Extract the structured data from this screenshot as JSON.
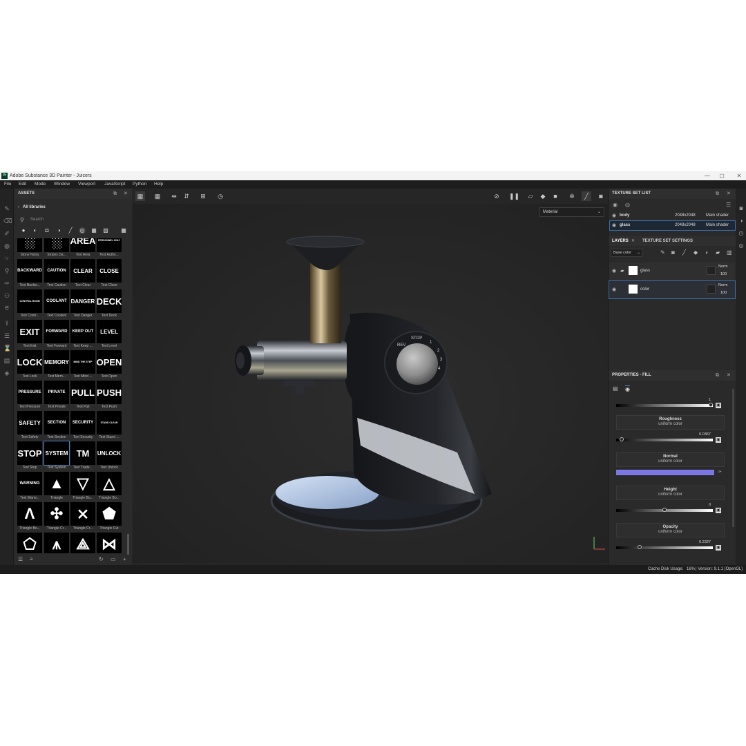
{
  "window": {
    "title": "Adobe Substance 3D Painter - Juicers",
    "app_logo": "Pt"
  },
  "menu": [
    "File",
    "Edit",
    "Mode",
    "Window",
    "Viewport",
    "JavaScript",
    "Python",
    "Help"
  ],
  "assets": {
    "title": "ASSETS",
    "library": "All libraries",
    "search_placeholder": "Search",
    "items": [
      {
        "thumb": "",
        "label": "Stone Noisy"
      },
      {
        "thumb": "",
        "label": "Stripes Da..."
      },
      {
        "thumb": "AREA",
        "label": "Text Area"
      },
      {
        "thumb": "PERSONNEL ONLY",
        "label": "Text Autho..."
      },
      {
        "thumb": "BACKWARD",
        "label": "Text Backw..."
      },
      {
        "thumb": "CAUTION",
        "label": "Text Caution"
      },
      {
        "thumb": "CLEAR",
        "label": "Text Clear"
      },
      {
        "thumb": "CLOSE",
        "label": "Text Close"
      },
      {
        "thumb": "CONTROL ROOM",
        "label": "Text Contr..."
      },
      {
        "thumb": "COOLANT",
        "label": "Text Coolant"
      },
      {
        "thumb": "DANGER",
        "label": "Text Danger"
      },
      {
        "thumb": "DECK",
        "label": "Text Deck"
      },
      {
        "thumb": "EXIT",
        "label": "Text Exit"
      },
      {
        "thumb": "FORWARD",
        "label": "Text Forward"
      },
      {
        "thumb": "KEEP OUT",
        "label": "Text Keep ..."
      },
      {
        "thumb": "LEVEL",
        "label": "Text Level"
      },
      {
        "thumb": "LOCK",
        "label": "Text Lock"
      },
      {
        "thumb": "MEMORY",
        "label": "Text Mem..."
      },
      {
        "thumb": "MIND THE STEP",
        "label": "Text Mind ..."
      },
      {
        "thumb": "OPEN",
        "label": "Text Open"
      },
      {
        "thumb": "PRESSURE",
        "label": "Text Pressure"
      },
      {
        "thumb": "PRIVATE",
        "label": "Text Private"
      },
      {
        "thumb": "PULL",
        "label": "Text Pull"
      },
      {
        "thumb": "PUSH",
        "label": "Text Push"
      },
      {
        "thumb": "SAFETY",
        "label": "Text Safety"
      },
      {
        "thumb": "SECTION",
        "label": "Text Section"
      },
      {
        "thumb": "SECURITY",
        "label": "Text Security"
      },
      {
        "thumb": "STAND CLEAR",
        "label": "Text Stand ..."
      },
      {
        "thumb": "STOP",
        "label": "Text Stop"
      },
      {
        "thumb": "SYSTEM",
        "label": "Text System"
      },
      {
        "thumb": "TM",
        "label": "Text Trade..."
      },
      {
        "thumb": "UNLOCK",
        "label": "Text Unlock"
      },
      {
        "thumb": "WARNING",
        "label": "Text Warni..."
      },
      {
        "thumb": "",
        "label": "Triangle"
      },
      {
        "thumb": "",
        "label": "Triangle Bo..."
      },
      {
        "thumb": "",
        "label": "Triangle Bo..."
      },
      {
        "thumb": "",
        "label": "Triangle Bo..."
      },
      {
        "thumb": "",
        "label": "Triangle Cr..."
      },
      {
        "thumb": "",
        "label": "Triangle Cr..."
      },
      {
        "thumb": "",
        "label": "Triangle Cut"
      },
      {
        "thumb": "",
        "label": ""
      },
      {
        "thumb": "",
        "label": ""
      },
      {
        "thumb": "",
        "label": ""
      },
      {
        "thumb": "",
        "label": ""
      }
    ],
    "selected_label": "Text System"
  },
  "viewport": {
    "material_mode": "Material",
    "dial_labels": {
      "rev": "REV",
      "stop": "STOP",
      "n1": "1",
      "n2": "2",
      "n3": "3",
      "n4": "4"
    }
  },
  "texture_set_list": {
    "title": "TEXTURE SET LIST",
    "rows": [
      {
        "name": "body",
        "resolution": "2048x2048",
        "shader": "Main shader"
      },
      {
        "name": "glass",
        "resolution": "2048x2048",
        "shader": "Main shader"
      }
    ]
  },
  "layers": {
    "tab_layers": "LAYERS",
    "tab_settings": "TEXTURE SET SETTINGS",
    "channel": "Base color",
    "items": [
      {
        "name": "glass",
        "blend": "Norm",
        "opacity": "100"
      },
      {
        "name": "color",
        "blend": "Norm",
        "opacity": "100"
      }
    ]
  },
  "properties": {
    "title": "PROPERTIES - FILL",
    "top_value": "1",
    "roughness": {
      "label": "Roughness",
      "mode": "uniform color",
      "value": "0.0367",
      "fraction": 0.0367
    },
    "normal": {
      "label": "Normal",
      "mode": "uniform color",
      "color": "#7b78e6"
    },
    "height": {
      "label": "Height",
      "mode": "uniform color",
      "value": "0",
      "fraction": 0.5
    },
    "opacity": {
      "label": "Opacity",
      "mode": "uniform color",
      "value": "0.2327",
      "fraction": 0.2327
    }
  },
  "status": {
    "cache_label": "Cache Disk Usage:",
    "cache_value": "16%",
    "version": "| Version: 9.1.1 (OpenGL)"
  },
  "colors": {
    "selection": "#3f6fa8",
    "panel": "#2a2a2a",
    "viewport": "#262626"
  }
}
